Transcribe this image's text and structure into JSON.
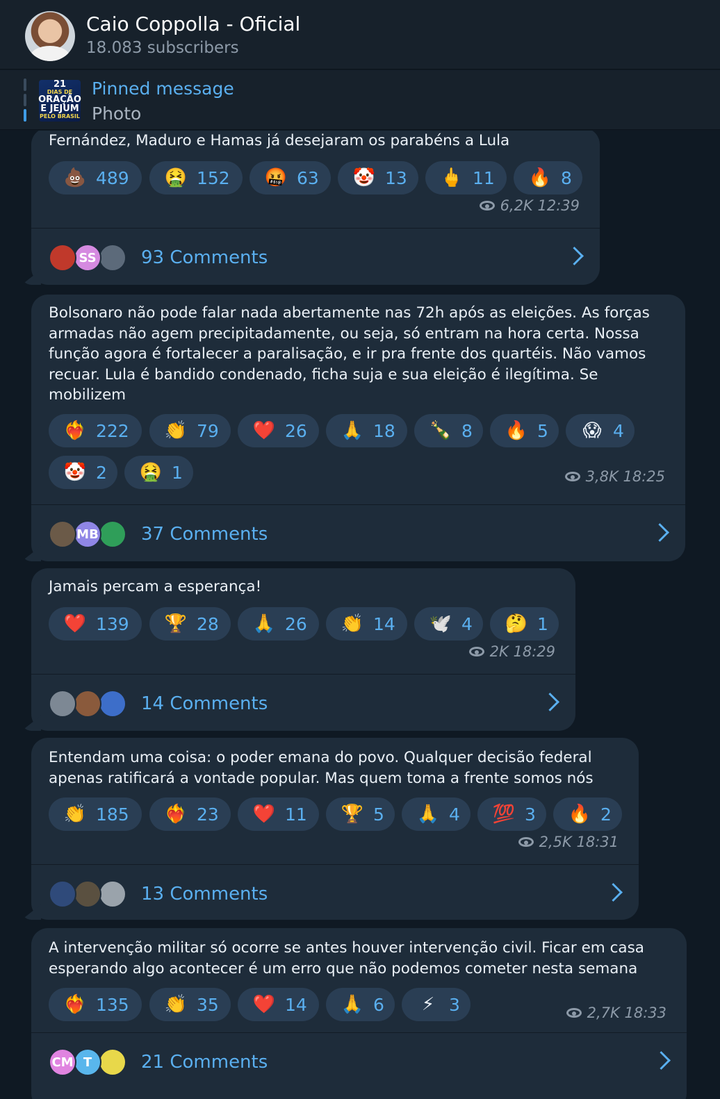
{
  "header": {
    "title": "Caio Coppolla - Oficial",
    "subscribers": "18.083 subscribers"
  },
  "pinned": {
    "title": "Pinned message",
    "subtitle": "Photo",
    "thumb": {
      "line1": "21",
      "line2": "DIAS DE",
      "line3": "ORAÇÃO",
      "line4": "E JEJUM",
      "line5": "PELO BRASIL"
    }
  },
  "messages": [
    {
      "text": "Fernández, Maduro e Hamas já desejaram os parabéns a Lula",
      "reactions": [
        {
          "icon": "poop-emoji",
          "emoji": "💩",
          "count": "489"
        },
        {
          "icon": "vomit-emoji",
          "emoji": "🤮",
          "count": "152"
        },
        {
          "icon": "swearing-emoji",
          "emoji": "🤬",
          "count": "63"
        },
        {
          "icon": "clown-emoji",
          "emoji": "🤡",
          "count": "13"
        },
        {
          "icon": "middle-finger-emoji",
          "emoji": "🖕",
          "count": "11"
        },
        {
          "icon": "fire-emoji",
          "emoji": "🔥",
          "count": "8"
        }
      ],
      "views": "6,2K",
      "time": "12:39",
      "comments": "93 Comments",
      "avatars": [
        {
          "label": "",
          "color": "#c0392b"
        },
        {
          "label": "SS",
          "color": "#d58ae0"
        },
        {
          "label": "",
          "color": "#5c6a7a"
        }
      ]
    },
    {
      "text": "Bolsonaro não pode falar nada abertamente nas 72h após as eleições. As forças armadas não agem precipitadamente, ou seja, só entram na hora certa. Nossa função agora é fortalecer a paralisação, e ir pra frente dos quartéis. Não vamos recuar. Lula é bandido condenado, ficha suja e sua eleição é ilegítima. Se mobilizem",
      "reactions": [
        {
          "icon": "heart-on-fire-emoji",
          "emoji": "❤️‍🔥",
          "count": "222"
        },
        {
          "icon": "clapping-emoji",
          "emoji": "👏",
          "count": "79"
        },
        {
          "icon": "heart-emoji",
          "emoji": "❤️",
          "count": "26"
        },
        {
          "icon": "pray-emoji",
          "emoji": "🙏",
          "count": "18"
        },
        {
          "icon": "champagne-emoji",
          "emoji": "🍾",
          "count": "8"
        },
        {
          "icon": "fire-emoji",
          "emoji": "🔥",
          "count": "5"
        },
        {
          "icon": "scream-emoji",
          "emoji": "😱",
          "count": "4"
        },
        {
          "icon": "clown-emoji",
          "emoji": "🤡",
          "count": "2"
        },
        {
          "icon": "vomit-emoji",
          "emoji": "🤮",
          "count": "1"
        }
      ],
      "views": "3,8K",
      "time": "18:25",
      "comments": "37 Comments",
      "avatars": [
        {
          "label": "",
          "color": "#6b5a48"
        },
        {
          "label": "MB",
          "color": "#8f86e6"
        },
        {
          "label": "",
          "color": "#2f9e59"
        }
      ]
    },
    {
      "text": "Jamais percam a esperança!",
      "reactions": [
        {
          "icon": "heart-emoji",
          "emoji": "❤️",
          "count": "139"
        },
        {
          "icon": "trophy-emoji",
          "emoji": "🏆",
          "count": "28"
        },
        {
          "icon": "pray-emoji",
          "emoji": "🙏",
          "count": "26"
        },
        {
          "icon": "clapping-emoji",
          "emoji": "👏",
          "count": "14"
        },
        {
          "icon": "dove-emoji",
          "emoji": "🕊️",
          "count": "4"
        },
        {
          "icon": "thinking-emoji",
          "emoji": "🤔",
          "count": "1"
        }
      ],
      "views": "2K",
      "time": "18:29",
      "comments": "14 Comments",
      "avatars": [
        {
          "label": "",
          "color": "#7d8894"
        },
        {
          "label": "",
          "color": "#8a5a3c"
        },
        {
          "label": "",
          "color": "#3d6ec9"
        }
      ]
    },
    {
      "text": "Entendam uma coisa: o poder emana do povo. Qualquer decisão federal apenas ratificará a vontade popular. Mas quem toma a frente somos nós",
      "reactions": [
        {
          "icon": "clapping-emoji",
          "emoji": "👏",
          "count": "185"
        },
        {
          "icon": "heart-on-fire-emoji",
          "emoji": "❤️‍🔥",
          "count": "23"
        },
        {
          "icon": "heart-emoji",
          "emoji": "❤️",
          "count": "11"
        },
        {
          "icon": "trophy-emoji",
          "emoji": "🏆",
          "count": "5"
        },
        {
          "icon": "pray-emoji",
          "emoji": "🙏",
          "count": "4"
        },
        {
          "icon": "hundred-emoji",
          "emoji": "💯",
          "count": "3"
        },
        {
          "icon": "fire-emoji",
          "emoji": "🔥",
          "count": "2"
        }
      ],
      "views": "2,5K",
      "time": "18:31",
      "comments": "13 Comments",
      "avatars": [
        {
          "label": "",
          "color": "#2f4a7a"
        },
        {
          "label": "",
          "color": "#5a5040"
        },
        {
          "label": "",
          "color": "#9aa3ab"
        }
      ]
    },
    {
      "text": "A intervenção militar só ocorre se antes houver intervenção civil. Ficar em casa esperando algo acontecer é um erro que não podemos cometer nesta semana",
      "reactions": [
        {
          "icon": "heart-on-fire-emoji",
          "emoji": "❤️‍🔥",
          "count": "135"
        },
        {
          "icon": "clapping-emoji",
          "emoji": "👏",
          "count": "35"
        },
        {
          "icon": "heart-emoji",
          "emoji": "❤️",
          "count": "14"
        },
        {
          "icon": "pray-emoji",
          "emoji": "🙏",
          "count": "6"
        },
        {
          "icon": "lightning-emoji",
          "emoji": "⚡",
          "count": "3"
        }
      ],
      "views": "2,7K",
      "time": "18:33",
      "comments": "21 Comments",
      "avatars": [
        {
          "label": "CM",
          "color": "#e084e0"
        },
        {
          "label": "T",
          "color": "#59b6ec"
        },
        {
          "label": "",
          "color": "#e8d84a"
        }
      ]
    }
  ]
}
